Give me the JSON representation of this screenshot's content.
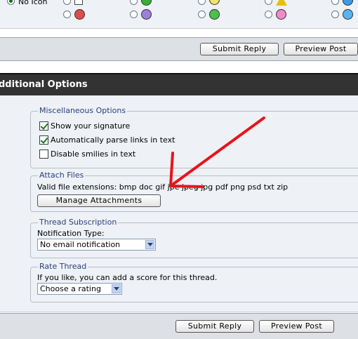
{
  "icon_strip": {
    "no_icon_label": "No Icon"
  },
  "top_buttons": {
    "submit_label": "Submit Reply",
    "preview_label": "Preview Post"
  },
  "section": {
    "title": "dditional Options"
  },
  "misc": {
    "legend": "Miscellaneous Options",
    "options": [
      {
        "label": "Show your signature",
        "checked": true
      },
      {
        "label": "Automatically parse links in text",
        "checked": true
      },
      {
        "label": "Disable smilies in text",
        "checked": false
      }
    ]
  },
  "attach": {
    "legend": "Attach Files",
    "extensions_text": "Valid file extensions: bmp doc gif jpe jpeg jpg pdf png psd txt zip",
    "manage_button": "Manage Attachments"
  },
  "subscription": {
    "legend": "Thread Subscription",
    "type_label": "Notification Type:",
    "selected": "No email notification"
  },
  "rating": {
    "legend": "Rate Thread",
    "prompt": "If you like, you can add a score for this thread.",
    "selected": "Choose a rating"
  },
  "bottom_buttons": {
    "submit_label": "Submit Reply",
    "preview_label": "Preview Post"
  },
  "colors": {
    "annotation_arrow": "#e8141c",
    "header_bg": "#333333",
    "legend_text": "#2a3f7a"
  }
}
